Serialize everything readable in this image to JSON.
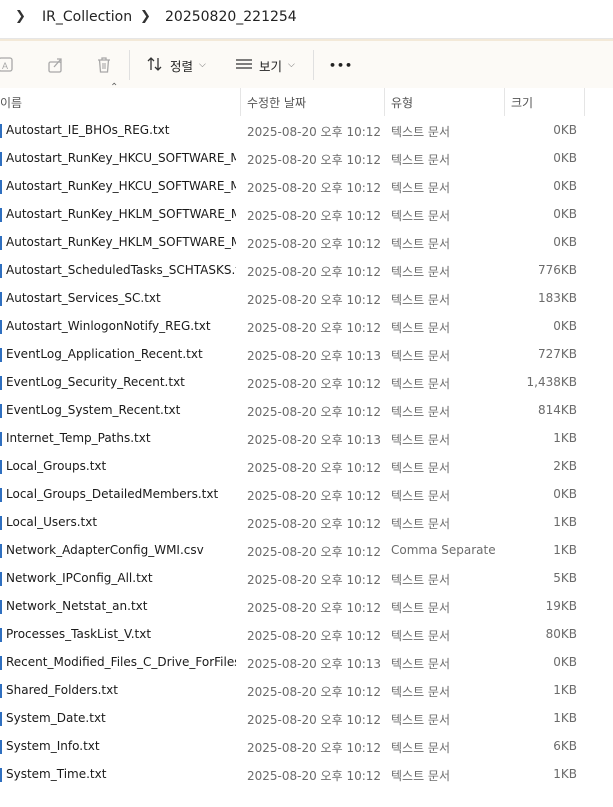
{
  "breadcrumb": {
    "items": [
      "IR_Collection",
      "20250820_221254"
    ]
  },
  "toolbar": {
    "sort_label": "정렬",
    "view_label": "보기",
    "more_label": "•••"
  },
  "columns": {
    "name": "이름",
    "date": "수정한 날짜",
    "type": "유형",
    "size": "크기"
  },
  "files": [
    {
      "name": "Autostart_IE_BHOs_REG.txt",
      "date": "2025-08-20 오후 10:12",
      "type": "텍스트 문서",
      "size": "0KB"
    },
    {
      "name": "Autostart_RunKey_HKCU_SOFTWARE_Mi...",
      "date": "2025-08-20 오후 10:12",
      "type": "텍스트 문서",
      "size": "0KB"
    },
    {
      "name": "Autostart_RunKey_HKCU_SOFTWARE_Mi...",
      "date": "2025-08-20 오후 10:12",
      "type": "텍스트 문서",
      "size": "0KB"
    },
    {
      "name": "Autostart_RunKey_HKLM_SOFTWARE_Mi...",
      "date": "2025-08-20 오후 10:12",
      "type": "텍스트 문서",
      "size": "0KB"
    },
    {
      "name": "Autostart_RunKey_HKLM_SOFTWARE_Mi...",
      "date": "2025-08-20 오후 10:12",
      "type": "텍스트 문서",
      "size": "0KB"
    },
    {
      "name": "Autostart_ScheduledTasks_SCHTASKS.txt",
      "date": "2025-08-20 오후 10:12",
      "type": "텍스트 문서",
      "size": "776KB"
    },
    {
      "name": "Autostart_Services_SC.txt",
      "date": "2025-08-20 오후 10:12",
      "type": "텍스트 문서",
      "size": "183KB"
    },
    {
      "name": "Autostart_WinlogonNotify_REG.txt",
      "date": "2025-08-20 오후 10:12",
      "type": "텍스트 문서",
      "size": "0KB"
    },
    {
      "name": "EventLog_Application_Recent.txt",
      "date": "2025-08-20 오후 10:13",
      "type": "텍스트 문서",
      "size": "727KB"
    },
    {
      "name": "EventLog_Security_Recent.txt",
      "date": "2025-08-20 오후 10:12",
      "type": "텍스트 문서",
      "size": "1,438KB"
    },
    {
      "name": "EventLog_System_Recent.txt",
      "date": "2025-08-20 오후 10:12",
      "type": "텍스트 문서",
      "size": "814KB"
    },
    {
      "name": "Internet_Temp_Paths.txt",
      "date": "2025-08-20 오후 10:13",
      "type": "텍스트 문서",
      "size": "1KB"
    },
    {
      "name": "Local_Groups.txt",
      "date": "2025-08-20 오후 10:12",
      "type": "텍스트 문서",
      "size": "2KB"
    },
    {
      "name": "Local_Groups_DetailedMembers.txt",
      "date": "2025-08-20 오후 10:12",
      "type": "텍스트 문서",
      "size": "0KB"
    },
    {
      "name": "Local_Users.txt",
      "date": "2025-08-20 오후 10:12",
      "type": "텍스트 문서",
      "size": "1KB"
    },
    {
      "name": "Network_AdapterConfig_WMI.csv",
      "date": "2025-08-20 오후 10:12",
      "type": "Comma Separate...",
      "size": "1KB"
    },
    {
      "name": "Network_IPConfig_All.txt",
      "date": "2025-08-20 오후 10:12",
      "type": "텍스트 문서",
      "size": "5KB"
    },
    {
      "name": "Network_Netstat_an.txt",
      "date": "2025-08-20 오후 10:12",
      "type": "텍스트 문서",
      "size": "19KB"
    },
    {
      "name": "Processes_TaskList_V.txt",
      "date": "2025-08-20 오후 10:12",
      "type": "텍스트 문서",
      "size": "80KB"
    },
    {
      "name": "Recent_Modified_Files_C_Drive_ForFiles.txt",
      "date": "2025-08-20 오후 10:13",
      "type": "텍스트 문서",
      "size": "0KB"
    },
    {
      "name": "Shared_Folders.txt",
      "date": "2025-08-20 오후 10:12",
      "type": "텍스트 문서",
      "size": "1KB"
    },
    {
      "name": "System_Date.txt",
      "date": "2025-08-20 오후 10:12",
      "type": "텍스트 문서",
      "size": "1KB"
    },
    {
      "name": "System_Info.txt",
      "date": "2025-08-20 오후 10:12",
      "type": "텍스트 문서",
      "size": "6KB"
    },
    {
      "name": "System_Time.txt",
      "date": "2025-08-20 오후 10:12",
      "type": "텍스트 문서",
      "size": "1KB"
    }
  ]
}
